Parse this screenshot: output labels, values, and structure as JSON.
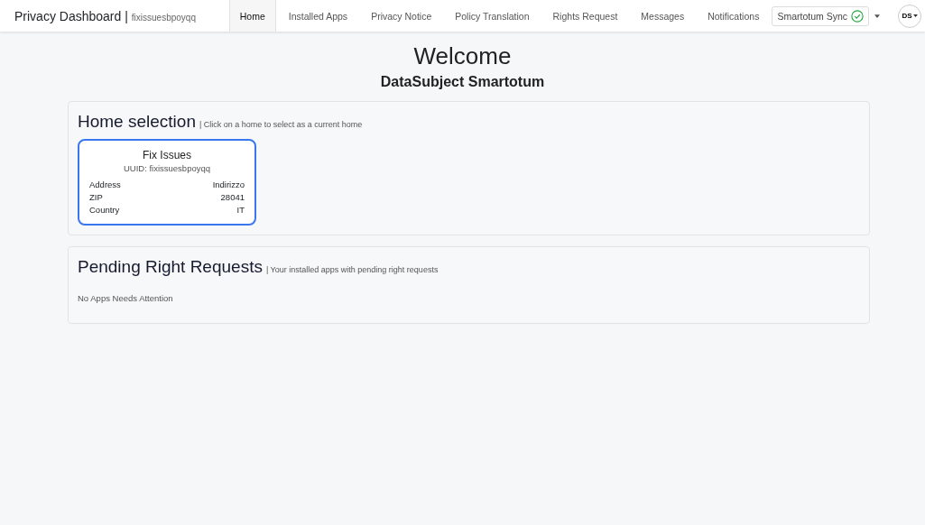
{
  "navbar": {
    "brand": "Privacy Dashboard |",
    "subtitle": "fixissuesbpoyqq",
    "tabs": [
      {
        "label": "Home",
        "selected": true
      },
      {
        "label": "Installed Apps",
        "selected": false
      },
      {
        "label": "Privacy Notice",
        "selected": false
      },
      {
        "label": "Policy Translation",
        "selected": false
      },
      {
        "label": "Rights Request",
        "selected": false
      },
      {
        "label": "Messages",
        "selected": false
      },
      {
        "label": "Notifications",
        "selected": false
      }
    ],
    "sync": {
      "label": "Smartotum Sync",
      "ok": true
    },
    "avatar": "DS"
  },
  "welcome": {
    "title": "Welcome",
    "subtitle": "DataSubject Smartotum"
  },
  "home_selection": {
    "title": "Home selection",
    "hint": "| Click on a home to select as a current home",
    "homes": [
      {
        "name": "Fix Issues",
        "uuid": "UUID: fixissuesbpoyqq",
        "selected": true,
        "fields": [
          {
            "label": "Address",
            "value": "Indirizzo"
          },
          {
            "label": "ZIP",
            "value": "28041"
          },
          {
            "label": "Country",
            "value": "IT"
          }
        ]
      }
    ]
  },
  "pending": {
    "title": "Pending Right Requests",
    "hint": "| Your installed apps with pending right requests",
    "empty": "No Apps Needs Attention"
  }
}
